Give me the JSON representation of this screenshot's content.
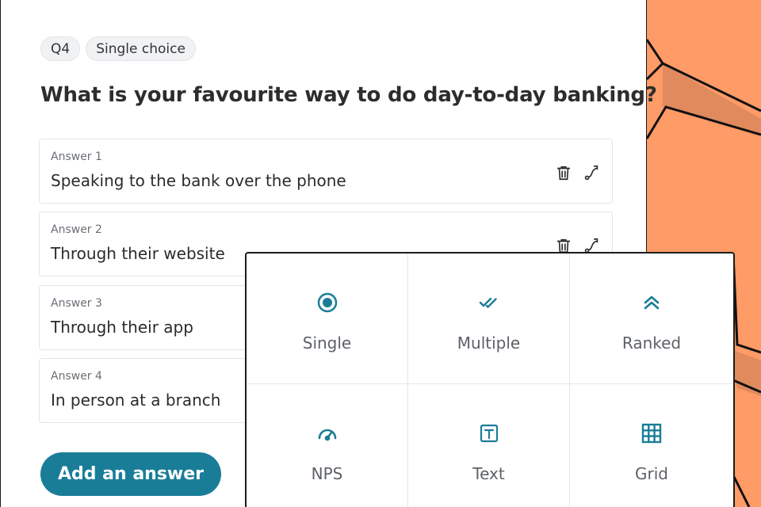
{
  "colors": {
    "accent": "#1a7d98",
    "background": "#ff9b66",
    "icon": "#1a7d98"
  },
  "question": {
    "number_chip": "Q4",
    "type_chip": "Single choice",
    "title": "What is your favourite way to do day-to-day banking?"
  },
  "answers": [
    {
      "label": "Answer 1",
      "text": "Speaking to the bank over the phone",
      "delete_icon": "trash-icon",
      "route_icon": "route-icon"
    },
    {
      "label": "Answer 2",
      "text": "Through their website",
      "delete_icon": "trash-icon",
      "route_icon": "route-icon"
    },
    {
      "label": "Answer 3",
      "text": "Through their app"
    },
    {
      "label": "Answer 4",
      "text": "In person at a branch"
    }
  ],
  "add_answer_label": "Add an answer",
  "question_types": [
    {
      "label": "Single",
      "icon": "radio-icon"
    },
    {
      "label": "Multiple",
      "icon": "double-check-icon"
    },
    {
      "label": "Ranked",
      "icon": "double-chevron-up-icon"
    },
    {
      "label": "NPS",
      "icon": "gauge-icon"
    },
    {
      "label": "Text",
      "icon": "text-box-icon"
    },
    {
      "label": "Grid",
      "icon": "grid-icon"
    }
  ]
}
